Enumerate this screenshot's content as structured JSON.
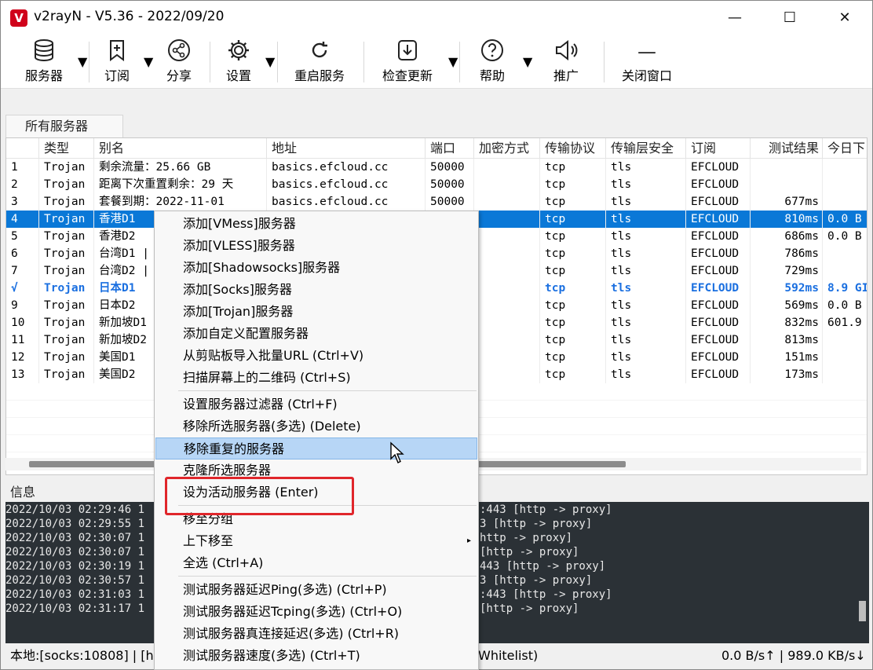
{
  "window": {
    "title": "v2rayN - V5.36 - 2022/09/20",
    "icon_letter": "V"
  },
  "toolbar": {
    "servers": "服务器",
    "subscribe": "订阅",
    "share": "分享",
    "settings": "设置",
    "restart": "重启服务",
    "check_update": "检查更新",
    "help": "帮助",
    "promote": "推广",
    "close_window": "关闭窗口"
  },
  "tab": {
    "all_servers": "所有服务器"
  },
  "columns": [
    "",
    "类型",
    "别名",
    "地址",
    "端口",
    "加密方式",
    "传输协议",
    "传输层安全",
    "订阅",
    "测试结果",
    "今日下"
  ],
  "rows": [
    {
      "idx": "1",
      "type": "Trojan",
      "alias": "剩余流量：25.66 GB",
      "addr": "basics.efcloud.cc",
      "port": "50000",
      "net": "tcp",
      "tls": "tls",
      "sub": "EFCLOUD",
      "test": "",
      "today": ""
    },
    {
      "idx": "2",
      "type": "Trojan",
      "alias": "距离下次重置剩余：29 天",
      "addr": "basics.efcloud.cc",
      "port": "50000",
      "net": "tcp",
      "tls": "tls",
      "sub": "EFCLOUD",
      "test": "",
      "today": ""
    },
    {
      "idx": "3",
      "type": "Trojan",
      "alias": "套餐到期：2022-11-01",
      "addr": "basics.efcloud.cc",
      "port": "50000",
      "net": "tcp",
      "tls": "tls",
      "sub": "EFCLOUD",
      "test": "677ms",
      "today": ""
    },
    {
      "idx": "4",
      "type": "Trojan",
      "alias": "香港D1",
      "addr": "",
      "port": "",
      "net": "tcp",
      "tls": "tls",
      "sub": "EFCLOUD",
      "test": "810ms",
      "today": "0.0 B"
    },
    {
      "idx": "5",
      "type": "Trojan",
      "alias": "香港D2",
      "addr": "",
      "port": "",
      "net": "tcp",
      "tls": "tls",
      "sub": "EFCLOUD",
      "test": "686ms",
      "today": "0.0 B"
    },
    {
      "idx": "6",
      "type": "Trojan",
      "alias": "台湾D1 |",
      "addr": "",
      "port": "",
      "net": "tcp",
      "tls": "tls",
      "sub": "EFCLOUD",
      "test": "786ms",
      "today": ""
    },
    {
      "idx": "7",
      "type": "Trojan",
      "alias": "台湾D2 |",
      "addr": "",
      "port": "",
      "net": "tcp",
      "tls": "tls",
      "sub": "EFCLOUD",
      "test": "729ms",
      "today": ""
    },
    {
      "idx": "√",
      "type": "Trojan",
      "alias": "日本D1",
      "addr": "",
      "port": "",
      "net": "tcp",
      "tls": "tls",
      "sub": "EFCLOUD",
      "test": "592ms",
      "today": "8.9 GI"
    },
    {
      "idx": "9",
      "type": "Trojan",
      "alias": "日本D2",
      "addr": "",
      "port": "",
      "net": "tcp",
      "tls": "tls",
      "sub": "EFCLOUD",
      "test": "569ms",
      "today": "0.0 B"
    },
    {
      "idx": "10",
      "type": "Trojan",
      "alias": "新加坡D1",
      "addr": "",
      "port": "",
      "net": "tcp",
      "tls": "tls",
      "sub": "EFCLOUD",
      "test": "832ms",
      "today": "601.9"
    },
    {
      "idx": "11",
      "type": "Trojan",
      "alias": "新加坡D2",
      "addr": "",
      "port": "",
      "net": "tcp",
      "tls": "tls",
      "sub": "EFCLOUD",
      "test": "813ms",
      "today": ""
    },
    {
      "idx": "12",
      "type": "Trojan",
      "alias": "美国D1",
      "addr": "",
      "port": "",
      "net": "tcp",
      "tls": "tls",
      "sub": "EFCLOUD",
      "test": "151ms",
      "today": ""
    },
    {
      "idx": "13",
      "type": "Trojan",
      "alias": "美国D2",
      "addr": "",
      "port": "",
      "net": "tcp",
      "tls": "tls",
      "sub": "EFCLOUD",
      "test": "173ms",
      "today": ""
    }
  ],
  "info_label": "信息",
  "log": [
    {
      "ts": "2022/10/03 02:29:46 1",
      "tail": ":443 [http -> proxy]"
    },
    {
      "ts": "2022/10/03 02:29:55 1",
      "tail": "3 [http -> proxy]"
    },
    {
      "ts": "2022/10/03 02:30:07 1",
      "tail": "http -> proxy]"
    },
    {
      "ts": "2022/10/03 02:30:07 1",
      "tail": " [http -> proxy]"
    },
    {
      "ts": "2022/10/03 02:30:19 1",
      "tail": "443 [http -> proxy]"
    },
    {
      "ts": "2022/10/03 02:30:57 1",
      "tail": "3 [http -> proxy]"
    },
    {
      "ts": "2022/10/03 02:31:03 1",
      "tail": ":443 [http -> proxy]"
    },
    {
      "ts": "2022/10/03 02:31:17 1",
      "tail": "  [http -> proxy]"
    }
  ],
  "status": {
    "left": "本地:[socks:10808] | [h",
    "mid": "Whitelist)",
    "right": "0.0 B/s↑ | 989.0 KB/s↓"
  },
  "context_menu": [
    {
      "label": "添加[VMess]服务器"
    },
    {
      "label": "添加[VLESS]服务器"
    },
    {
      "label": "添加[Shadowsocks]服务器"
    },
    {
      "label": "添加[Socks]服务器"
    },
    {
      "label": "添加[Trojan]服务器"
    },
    {
      "label": "添加自定义配置服务器"
    },
    {
      "label": "从剪贴板导入批量URL (Ctrl+V)"
    },
    {
      "label": "扫描屏幕上的二维码 (Ctrl+S)"
    },
    {
      "label": "设置服务器过滤器 (Ctrl+F)"
    },
    {
      "label": "移除所选服务器(多选) (Delete)"
    },
    {
      "label": "移除重复的服务器"
    },
    {
      "label": "克隆所选服务器"
    },
    {
      "label": "设为活动服务器 (Enter)"
    },
    {
      "label": "移至分组"
    },
    {
      "label": "上下移至"
    },
    {
      "label": "全选 (Ctrl+A)"
    },
    {
      "label": "测试服务器延迟Ping(多选) (Ctrl+P)"
    },
    {
      "label": "测试服务器延迟Tcping(多选) (Ctrl+O)"
    },
    {
      "label": "测试服务器真连接延迟(多选) (Ctrl+R)"
    },
    {
      "label": "测试服务器速度(多选) (Ctrl+T)"
    }
  ],
  "colors": {
    "selection": "#0a78d7",
    "active_row_text": "#1a6fe0",
    "menu_highlight": "#b7d6f6",
    "annotation_box": "#e0262b",
    "log_bg": "#2b3136"
  }
}
